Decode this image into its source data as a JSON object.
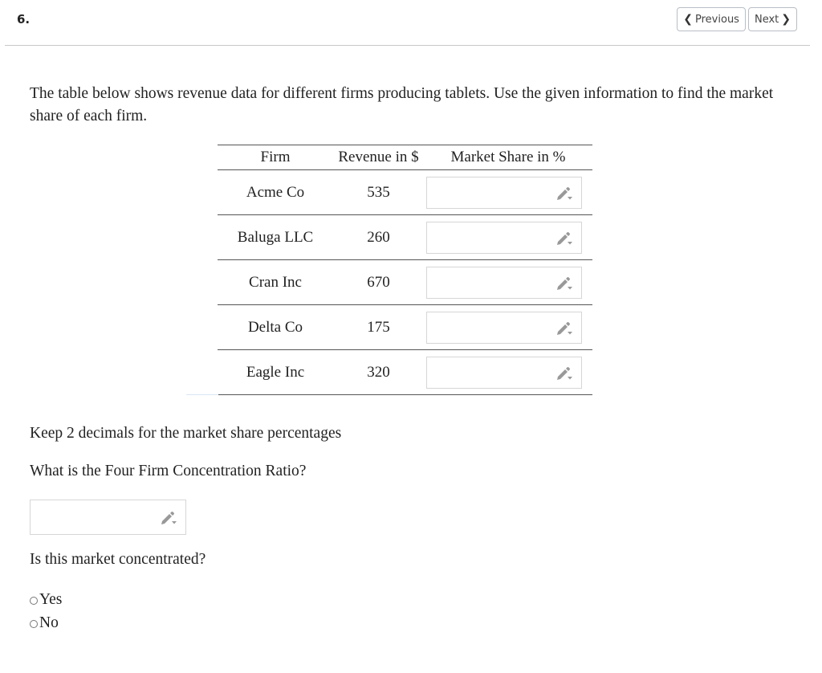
{
  "header": {
    "question_number": "6.",
    "prev_label": "Previous",
    "next_label": "Next",
    "prev_icon": "chevron-left-icon",
    "next_icon": "chevron-right-icon"
  },
  "question": {
    "intro": "The table below shows revenue data for different firms producing tablets. Use the given information to find the market share of each firm.",
    "table": {
      "headers": [
        "Firm",
        "Revenue in $",
        "Market Share in %"
      ],
      "rows": [
        {
          "firm": "Acme Co",
          "revenue": "535",
          "market_share": ""
        },
        {
          "firm": "Baluga LLC",
          "revenue": "260",
          "market_share": ""
        },
        {
          "firm": "Cran Inc",
          "revenue": "670",
          "market_share": ""
        },
        {
          "firm": "Delta Co",
          "revenue": "175",
          "market_share": ""
        },
        {
          "firm": "Eagle Inc",
          "revenue": "320",
          "market_share": ""
        }
      ],
      "input_icon": "pencil-dropdown-icon"
    },
    "decimals_note": "Keep 2 decimals for the market share percentages",
    "cr4_prompt": "What is the Four Firm Concentration Ratio?",
    "cr4_value": "",
    "concentrated_prompt": "Is this market concentrated?",
    "options": [
      "Yes",
      "No"
    ]
  }
}
